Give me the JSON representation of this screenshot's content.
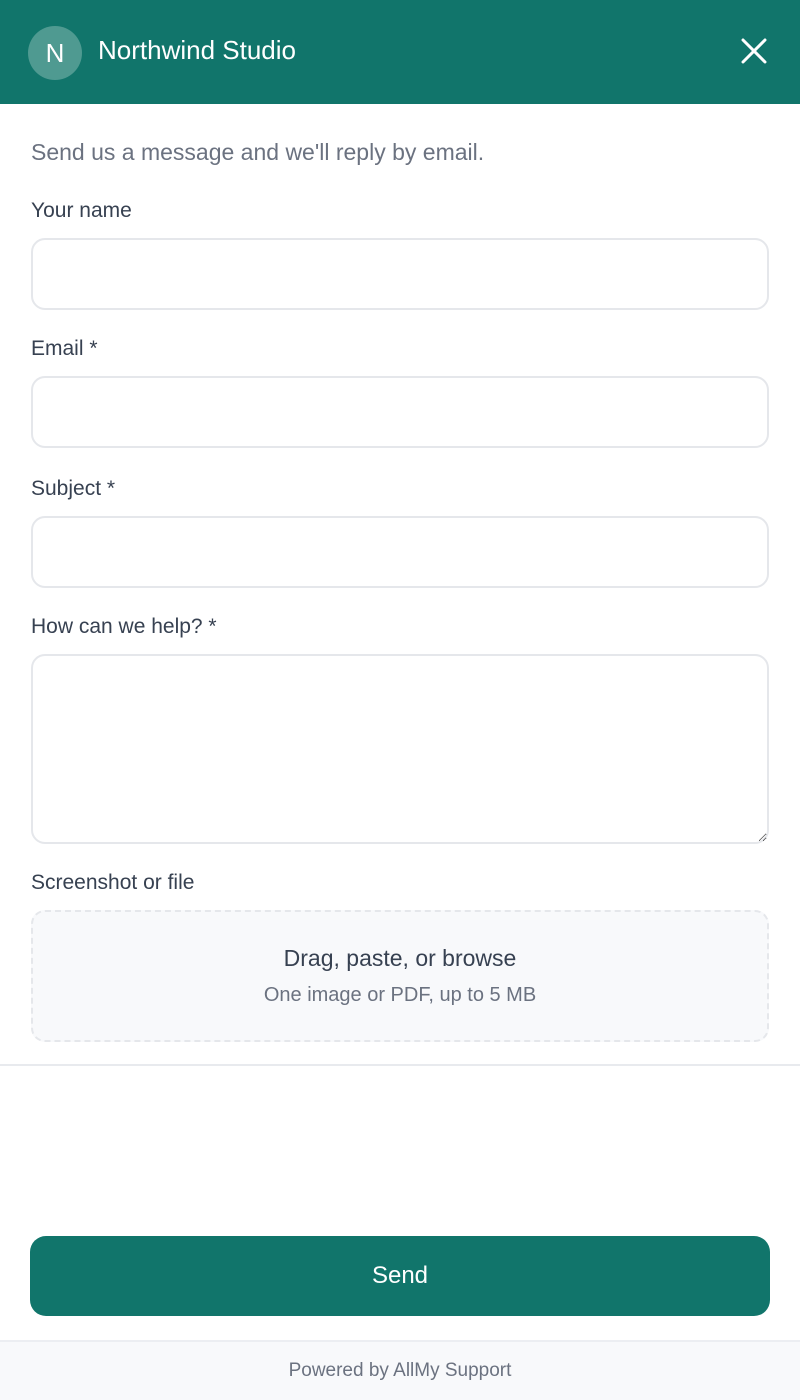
{
  "colors": {
    "brand": "#11756b",
    "avatar_bg": "#4f9a91",
    "muted_text": "#6b7280",
    "label_text": "#374151",
    "border": "#e5e7eb",
    "surface_muted": "#f8f9fb"
  },
  "header": {
    "avatar_letter": "N",
    "title": "Northwind Studio",
    "close_icon": "close-icon"
  },
  "intro": "Send us a message and we'll reply by email.",
  "form": {
    "name_label": "Your name",
    "name_value": "",
    "email_label": "Email *",
    "email_value": "",
    "subject_label": "Subject *",
    "subject_value": "",
    "message_label": "How can we help? *",
    "message_value": "",
    "attachment_label": "Screenshot or file",
    "dropzone_main": "Drag, paste, or browse",
    "dropzone_sub": "One image or PDF, up to 5 MB"
  },
  "send_label": "Send",
  "footer": "Powered by AllMy Support"
}
